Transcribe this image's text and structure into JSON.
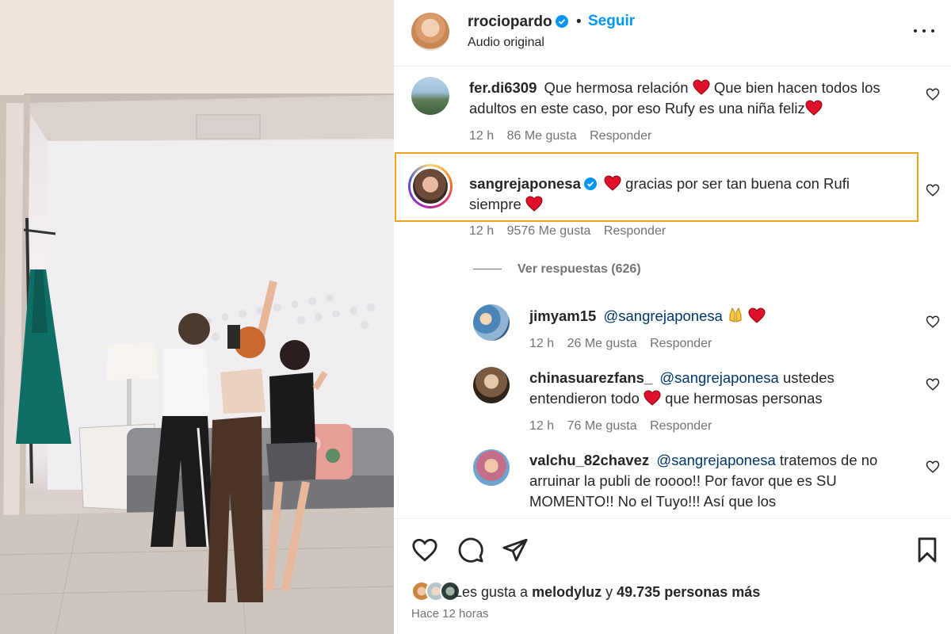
{
  "header": {
    "username": "rrociopardo",
    "dot": "•",
    "follow_label": "Seguir",
    "subtitle": "Audio original"
  },
  "comments": [
    {
      "username": "fer.di6309",
      "text_a": "Que hermosa relación",
      "text_b": "Que bien hacen todos los adultos en este caso, por eso Rufy es una niña feliz",
      "time": "12 h",
      "likes": "86 Me gusta",
      "reply_label": "Responder"
    },
    {
      "username": "sangrejaponesa",
      "text_a": "gracias por ser tan buena con Rufi siempre",
      "time": "12 h",
      "likes": "9576 Me gusta",
      "reply_label": "Responder",
      "highlight_color": "#f0a31a"
    }
  ],
  "view_replies": "Ver respuestas (626)",
  "replies": [
    {
      "username": "jimyam15",
      "mention": "@sangrejaponesa",
      "time": "12 h",
      "likes": "26 Me gusta",
      "reply_label": "Responder"
    },
    {
      "username": "chinasuarezfans_",
      "mention": "@sangrejaponesa",
      "text_a": "ustedes entendieron todo",
      "text_b": "que hermosas personas",
      "time": "12 h",
      "likes": "76 Me gusta",
      "reply_label": "Responder"
    },
    {
      "username": "valchu_82chavez",
      "mention": "@sangrejaponesa",
      "text_a": "tratemos de no arruinar la publi de roooo!! Por favor que es SU MOMENTO!! No el Tuyo!!! Así que los"
    }
  ],
  "footer": {
    "likes_prefix": "Les gusta a",
    "likes_user": "melodyluz",
    "likes_mid": "y",
    "likes_count": "49.735 personas más",
    "time_ago": "Hace 12 horas"
  },
  "colors": {
    "follow": "#0095f6",
    "verified": "#0095f6",
    "heart_emoji": "#e0102a",
    "meta_gray": "#737373"
  },
  "icons": [
    "verified-badge-icon",
    "more-options-icon",
    "heart-icon",
    "comment-icon",
    "share-icon",
    "bookmark-icon",
    "red-heart-emoji",
    "praying-hands-emoji"
  ]
}
